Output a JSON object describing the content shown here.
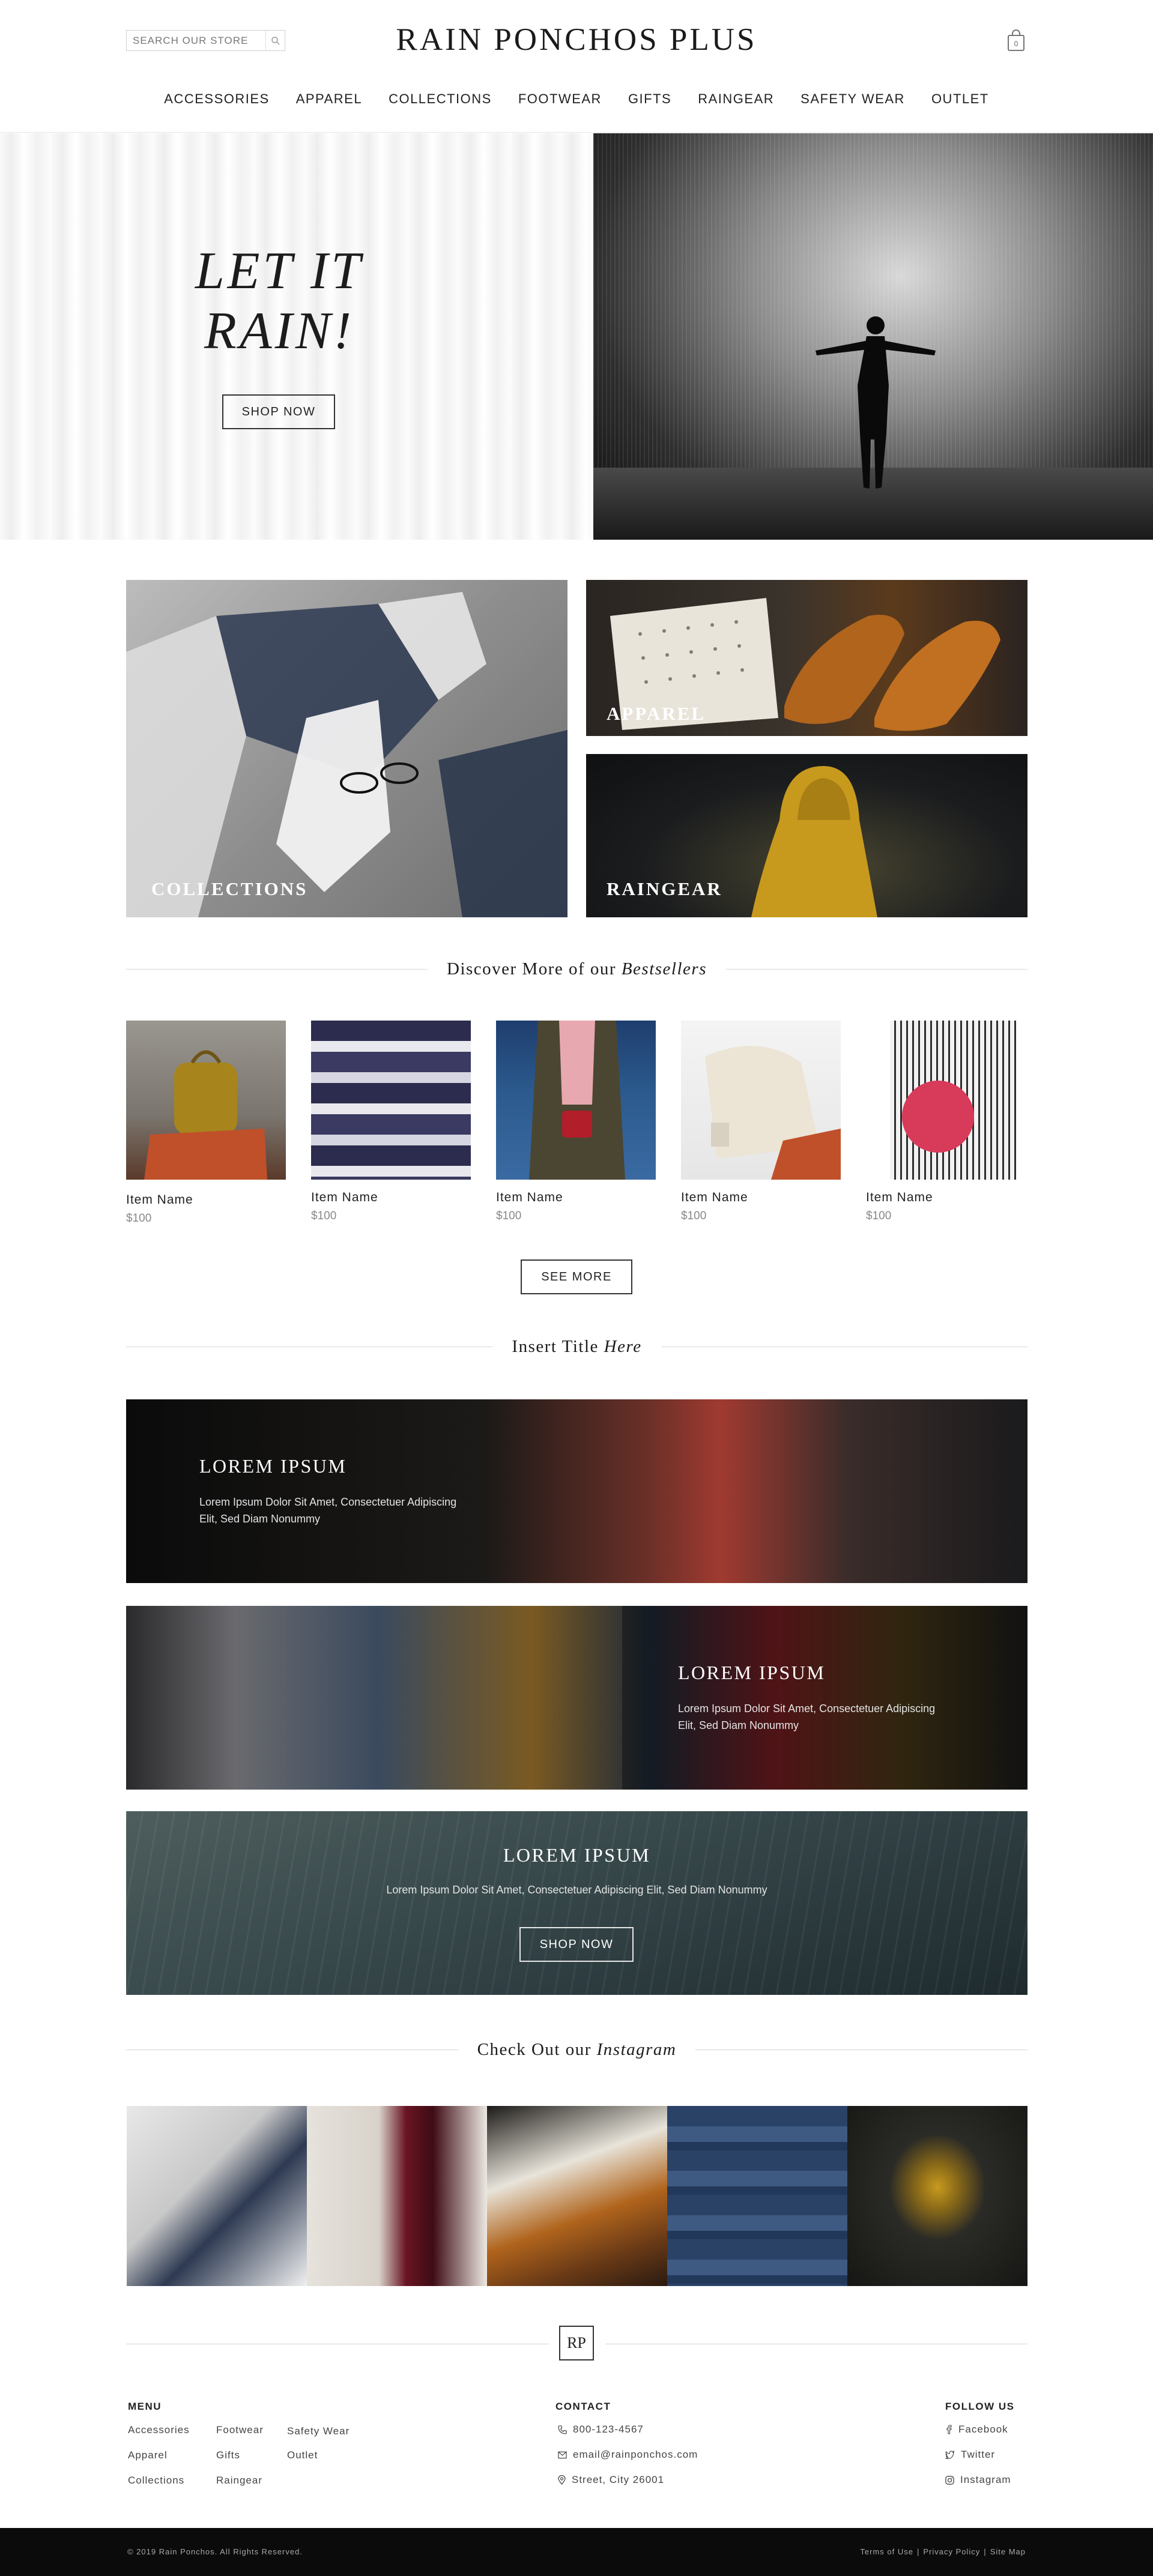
{
  "header": {
    "search_placeholder": "SEARCH OUR STORE",
    "logo": "RAIN PONCHOS PLUS",
    "cart_count": "0",
    "nav": [
      "ACCESSORIES",
      "APPAREL",
      "COLLECTIONS",
      "FOOTWEAR",
      "GIFTS",
      "RAINGEAR",
      "SAFETY WEAR",
      "OUTLET"
    ]
  },
  "hero": {
    "title_line1": "LET IT",
    "title_line2": "RAIN!",
    "button": "SHOP NOW"
  },
  "categories": {
    "collections": "COLLECTIONS",
    "apparel": "APPAREL",
    "raingear": "RAINGEAR"
  },
  "bestsellers": {
    "heading_plain": "Discover More of our",
    "heading_italic": "Bestsellers",
    "products": [
      {
        "name": "Item Name",
        "price": "$100"
      },
      {
        "name": "Item Name",
        "price": "$100"
      },
      {
        "name": "Item Name",
        "price": "$100"
      },
      {
        "name": "Item Name",
        "price": "$100"
      },
      {
        "name": "Item Name",
        "price": "$100"
      }
    ],
    "see_more": "SEE MORE"
  },
  "feature": {
    "heading_plain": "Insert Title",
    "heading_italic": "Here",
    "banners": [
      {
        "title": "LOREM IPSUM",
        "text_line1": "Lorem Ipsum Dolor Sit Amet, Consectetuer Adipiscing",
        "text_line2": "Elit, Sed Diam Nonummy"
      },
      {
        "title": "LOREM IPSUM",
        "text_line1": "Lorem Ipsum Dolor Sit Amet, Consectetuer Adipiscing",
        "text_line2": "Elit, Sed Diam Nonummy"
      },
      {
        "title": "LOREM IPSUM",
        "text_line1": "Lorem Ipsum Dolor Sit Amet, Consectetuer Adipiscing Elit, Sed Diam Nonummy",
        "button": "SHOP NOW"
      }
    ]
  },
  "instagram": {
    "heading_plain": "Check Out our",
    "heading_italic": "Instagram"
  },
  "footer": {
    "badge": "RP",
    "menu_heading": "MENU",
    "menu": [
      "Accessories",
      "Apparel",
      "Collections",
      "Footwear",
      "Gifts",
      "Raingear",
      "Safety Wear",
      "Outlet"
    ],
    "contact_heading": "CONTACT",
    "phone": "800-123-4567",
    "email": "email@rainponchos.com",
    "address": "Street, City 26001",
    "follow_heading": "FOLLOW US",
    "social": [
      "Facebook",
      "Twitter",
      "Instagram"
    ],
    "copyright": "© 2019 Rain Ponchos. All Rights Reserved.",
    "legal": [
      "Terms of Use",
      "|",
      "Privacy Policy",
      "|",
      "Site Map"
    ]
  },
  "colors": {
    "accent": "#222222",
    "footer_bar": "#0b0b0b",
    "divider": "#d6d6d6"
  }
}
